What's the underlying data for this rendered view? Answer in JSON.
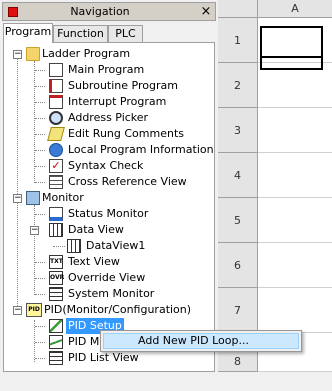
{
  "nav": {
    "title": "Navigation",
    "close": "×",
    "tabs": [
      {
        "label": "Program",
        "active": true
      },
      {
        "label": "Function",
        "active": false
      },
      {
        "label": "PLC",
        "active": false
      }
    ]
  },
  "tree": {
    "ladder_program": "Ladder Program",
    "main_program": "Main Program",
    "subroutine_program": "Subroutine Program",
    "interrupt_program": "Interrupt Program",
    "address_picker": "Address Picker",
    "edit_rung_comments": "Edit Rung Comments",
    "local_program_information": "Local Program Information",
    "syntax_check": "Syntax Check",
    "cross_reference_view": "Cross Reference View",
    "monitor": "Monitor",
    "status_monitor": "Status Monitor",
    "data_view": "Data View",
    "dataview1": "DataView1",
    "text_view": "Text View",
    "override_view": "Override View",
    "system_monitor": "System Monitor",
    "pid": "PID(Monitor/Configuration)",
    "pid_setup": "PID Setup",
    "pid_monitor": "PID Mc",
    "pid_list_view": "PID List View",
    "icon_txt": "TXT",
    "icon_ovr": "OVR",
    "icon_pid": "PID"
  },
  "grid": {
    "column": "A",
    "rows": [
      "1",
      "2",
      "3",
      "4",
      "5",
      "6",
      "7",
      "8"
    ]
  },
  "context_menu": {
    "item": "Add New PID Loop..."
  }
}
